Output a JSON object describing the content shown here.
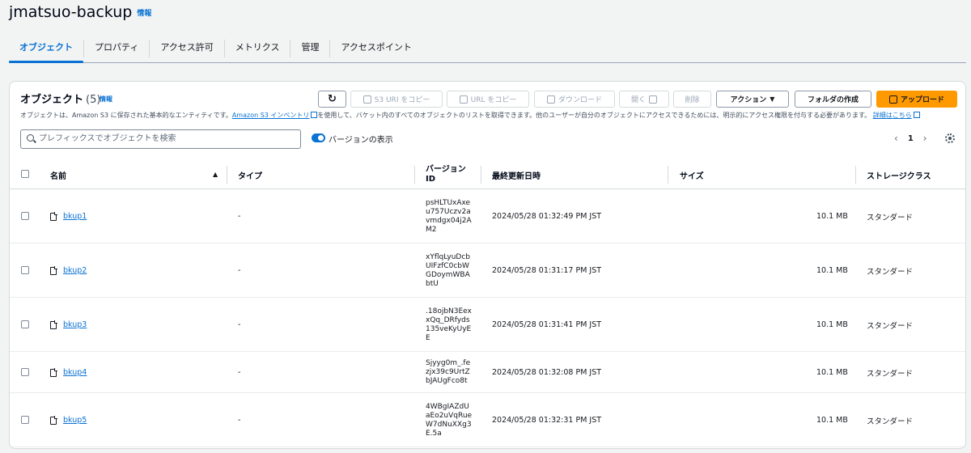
{
  "header": {
    "title": "jmatsuo-backup",
    "info": "情報"
  },
  "tabs": [
    "オブジェクト",
    "プロパティ",
    "アクセス許可",
    "メトリクス",
    "管理",
    "アクセスポイント"
  ],
  "panel": {
    "title": "オブジェクト",
    "count": "(5)",
    "info": "情報",
    "description_pre": "オブジェクトは、Amazon S3 に保存された基本的なエンティティです。",
    "description_link": "Amazon S3 インベントリ",
    "description_mid": "を使用して、バケット内のすべてのオブジェクトのリストを取得できます。他のユーザーが自分のオブジェクトにアクセスできるためには、明示的にアクセス権限を付与する必要があります。",
    "description_link2": "詳細はこちら"
  },
  "toolbar": {
    "copy_s3_uri": "S3 URI をコピー",
    "copy_url": "URL をコピー",
    "download": "ダウンロード",
    "open": "開く",
    "delete": "削除",
    "actions": "アクション",
    "create_folder": "フォルダの作成",
    "upload": "アップロード"
  },
  "search": {
    "placeholder": "プレフィックスでオブジェクトを検索"
  },
  "versions_toggle": {
    "label": "バージョンの表示",
    "on": true
  },
  "pagination": {
    "page": "1"
  },
  "columns": [
    "名前",
    "タイプ",
    "バージョン ID",
    "最終更新日時",
    "サイズ",
    "ストレージクラス"
  ],
  "rows": [
    {
      "name": "bkup1",
      "type": "-",
      "version_id": "psHLTUxAxeu757Uczv2avmdgx04j2AM2",
      "modified": "2024/05/28 01:32:49 PM JST",
      "size": "10.1 MB",
      "storage_class": "スタンダード"
    },
    {
      "name": "bkup2",
      "type": "-",
      "version_id": "xYflqLyuDcbUIFzfC0cbWGDoymWBAbtU",
      "modified": "2024/05/28 01:31:17 PM JST",
      "size": "10.1 MB",
      "storage_class": "スタンダード"
    },
    {
      "name": "bkup3",
      "type": "-",
      "version_id": ".18ojbN3EexxQq_DRfyds135veKyUyEE",
      "modified": "2024/05/28 01:31:41 PM JST",
      "size": "10.1 MB",
      "storage_class": "スタンダード"
    },
    {
      "name": "bkup4",
      "type": "-",
      "version_id": "Sjyyg0m_.fezjx39c9UrtZbJAUgFco8t",
      "modified": "2024/05/28 01:32:08 PM JST",
      "size": "10.1 MB",
      "storage_class": "スタンダード"
    },
    {
      "name": "bkup5",
      "type": "-",
      "version_id": "4WBgIAZdUaEo2uVqRueW7dNuXXg3E.5a",
      "modified": "2024/05/28 01:32:31 PM JST",
      "size": "10.1 MB",
      "storage_class": "スタンダード"
    }
  ]
}
